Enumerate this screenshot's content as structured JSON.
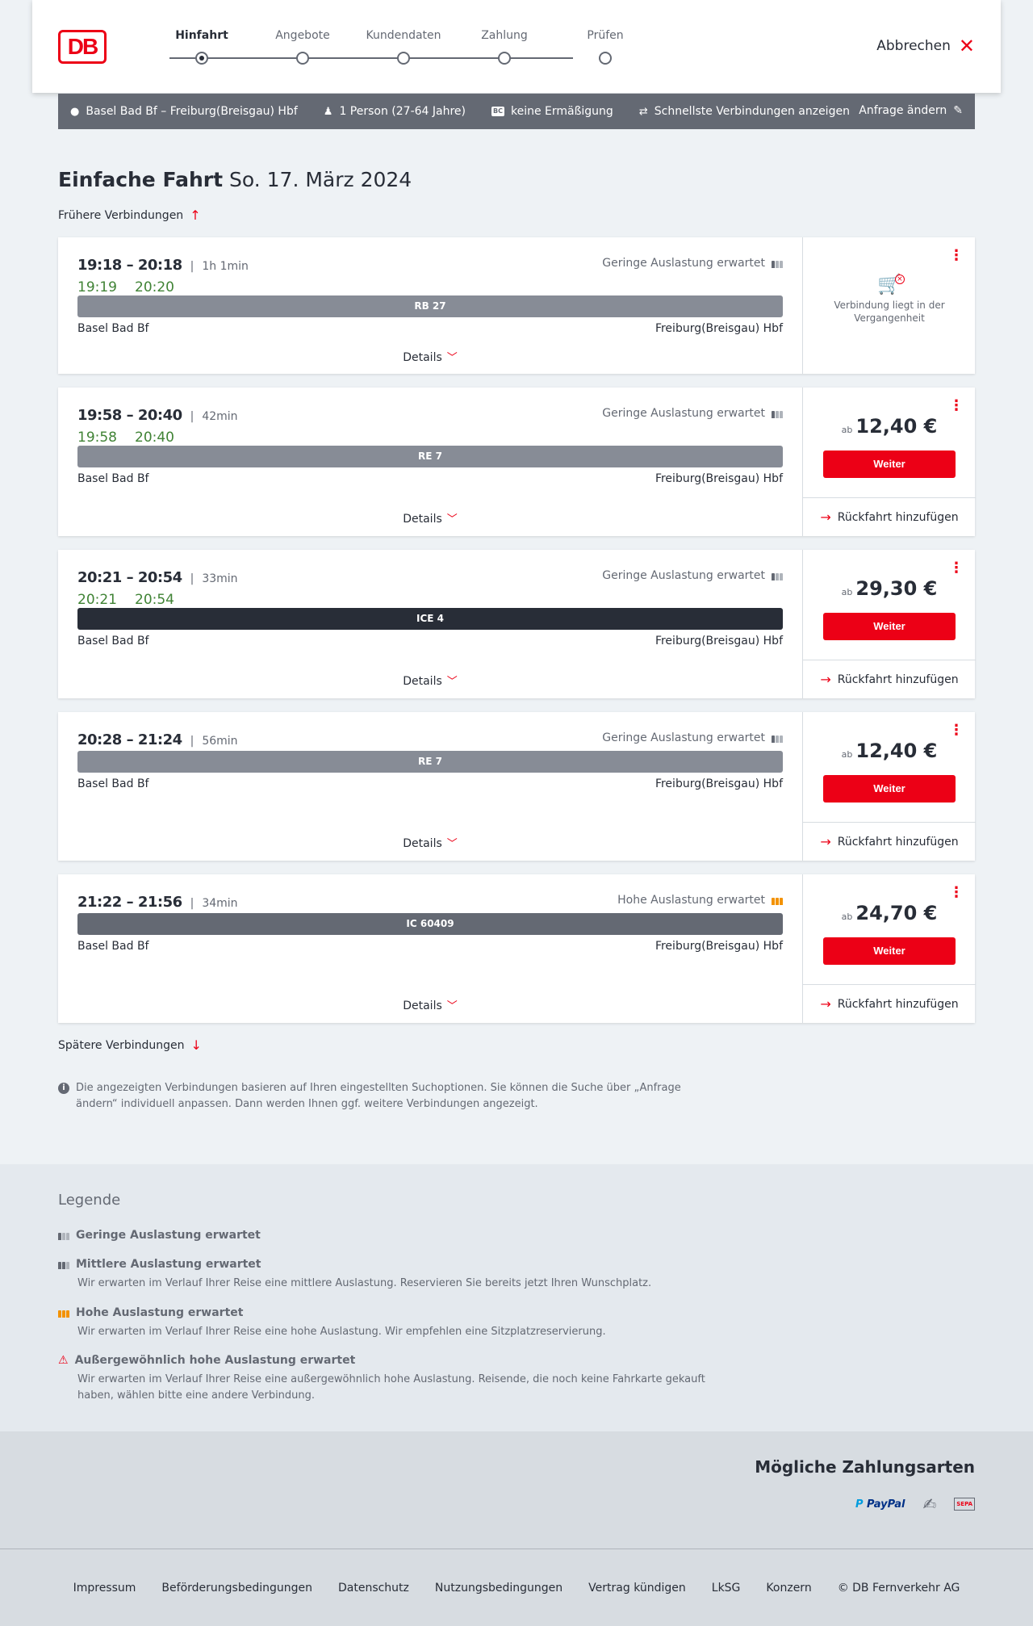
{
  "header": {
    "logo_text": "DB",
    "steps": [
      "Hinfahrt",
      "Angebote",
      "Kundendaten",
      "Zahlung",
      "Prüfen"
    ],
    "active_step": 0,
    "cancel_label": "Abbrechen"
  },
  "summary": {
    "route": "Basel Bad Bf – Freiburg(Breisgau) Hbf",
    "passengers": "1 Person (27-64 Jahre)",
    "bahncard_badge": "BC",
    "discount": "keine Ermäßigung",
    "fastest": "Schnellste Verbindungen anzeigen",
    "edit": "Anfrage ändern"
  },
  "title": {
    "main": "Einfache Fahrt",
    "date": "So. 17. März 2024"
  },
  "earlier": "Frühere Verbindungen",
  "later": "Spätere Verbindungen",
  "connections": [
    {
      "time": "19:18 – 20:18",
      "duration": "1h 1min",
      "realtime_dep": "19:19",
      "realtime_arr": "20:20",
      "occupancy": "Geringe Auslastung erwartet",
      "occupancy_level": "low",
      "train": "RB 27",
      "train_color": "#878c96",
      "from": "Basel Bad Bf",
      "to": "Freiburg(Breisgau) Hbf",
      "details": "Details",
      "past": true,
      "past_text": "Verbindung liegt in der Vergangenheit"
    },
    {
      "time": "19:58 – 20:40",
      "duration": "42min",
      "realtime_dep": "19:58",
      "realtime_arr": "20:40",
      "occupancy": "Geringe Auslastung erwartet",
      "occupancy_level": "low",
      "train": "RE 7",
      "train_color": "#878c96",
      "from": "Basel Bad Bf",
      "to": "Freiburg(Breisgau) Hbf",
      "details": "Details",
      "past": false,
      "price_prefix": "ab",
      "price": "12,40 €",
      "button": "Weiter",
      "return": "Rückfahrt hinzufügen"
    },
    {
      "time": "20:21 – 20:54",
      "duration": "33min",
      "realtime_dep": "20:21",
      "realtime_arr": "20:54",
      "occupancy": "Geringe Auslastung erwartet",
      "occupancy_level": "low",
      "train": "ICE 4",
      "train_color": "#282d37",
      "from": "Basel Bad Bf",
      "to": "Freiburg(Breisgau) Hbf",
      "details": "Details",
      "past": false,
      "price_prefix": "ab",
      "price": "29,30 €",
      "button": "Weiter",
      "return": "Rückfahrt hinzufügen"
    },
    {
      "time": "20:28 – 21:24",
      "duration": "56min",
      "occupancy": "Geringe Auslastung erwartet",
      "occupancy_level": "low",
      "train": "RE 7",
      "train_color": "#878c96",
      "from": "Basel Bad Bf",
      "to": "Freiburg(Breisgau) Hbf",
      "details": "Details",
      "past": false,
      "price_prefix": "ab",
      "price": "12,40 €",
      "button": "Weiter",
      "return": "Rückfahrt hinzufügen"
    },
    {
      "time": "21:22 – 21:56",
      "duration": "34min",
      "occupancy": "Hohe Auslastung erwartet",
      "occupancy_level": "high",
      "train": "IC 60409",
      "train_color": "#646973",
      "from": "Basel Bad Bf",
      "to": "Freiburg(Breisgau) Hbf",
      "details": "Details",
      "past": false,
      "price_prefix": "ab",
      "price": "24,70 €",
      "button": "Weiter",
      "return": "Rückfahrt hinzufügen"
    }
  ],
  "info": "Die angezeigten Verbindungen basieren auf Ihren eingestellten Suchoptionen. Sie können die Suche über „Anfrage ändern“ individuell anpassen. Dann werden Ihnen ggf. weitere Verbindungen angezeigt.",
  "legend": {
    "title": "Legende",
    "items": [
      {
        "title": "Geringe Auslastung erwartet",
        "desc": ""
      },
      {
        "title": "Mittlere Auslastung erwartet",
        "desc": "Wir erwarten im Verlauf Ihrer Reise eine mittlere Auslastung. Reservieren Sie bereits jetzt Ihren Wunschplatz."
      },
      {
        "title": "Hohe Auslastung erwartet",
        "desc": "Wir erwarten im Verlauf Ihrer Reise eine hohe Auslastung. Wir empfehlen eine Sitzplatzreservierung."
      },
      {
        "title": "Außergewöhnlich hohe Auslastung erwartet",
        "desc": "Wir erwarten im Verlauf Ihrer Reise eine außergewöhnlich hohe Auslastung. Reisende, die noch keine Fahrkarte gekauft haben, wählen bitte eine andere Verbindung."
      }
    ]
  },
  "payments": {
    "title": "Mögliche Zahlungsarten",
    "paypal_a": "P PayPal",
    "sepa": "SEPA"
  },
  "footer": [
    "Impressum",
    "Beförderungsbedingungen",
    "Datenschutz",
    "Nutzungsbedingungen",
    "Vertrag kündigen",
    "LkSG",
    "Konzern",
    "© DB Fernverkehr AG"
  ]
}
